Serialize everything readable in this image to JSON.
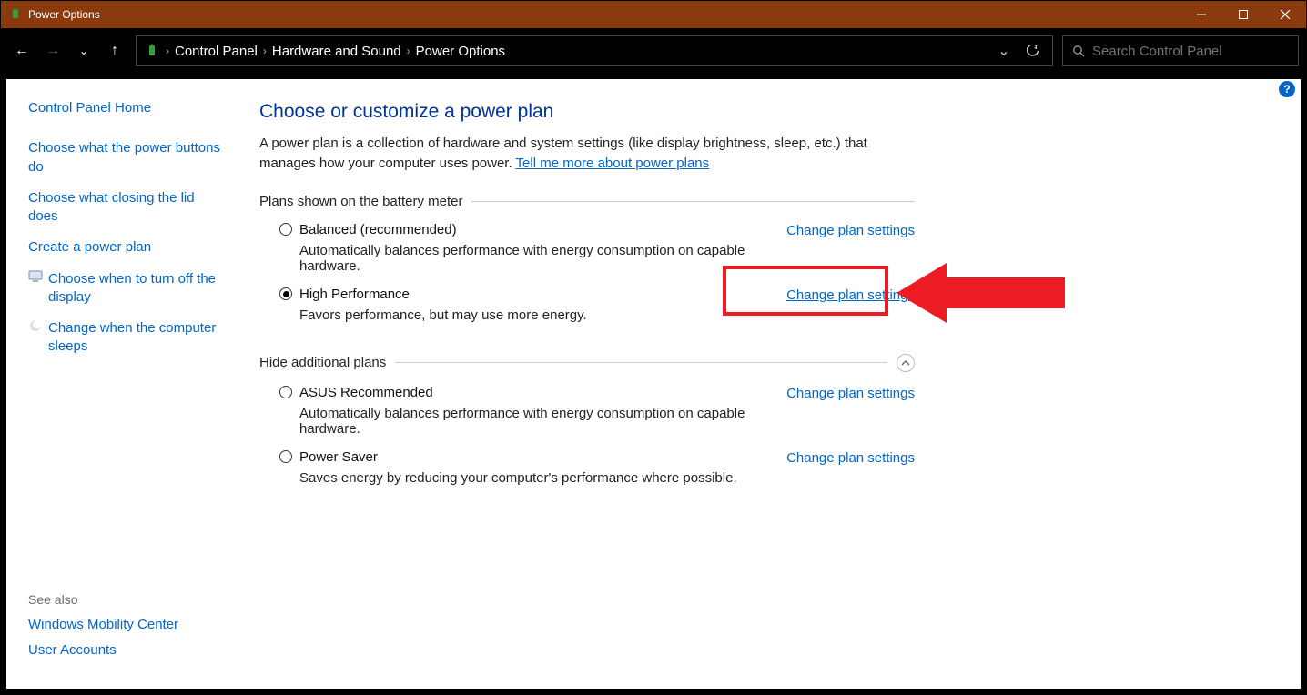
{
  "window": {
    "title": "Power Options"
  },
  "breadcrumbs": {
    "a": "Control Panel",
    "b": "Hardware and Sound",
    "c": "Power Options"
  },
  "search": {
    "placeholder": "Search Control Panel"
  },
  "sidebar": {
    "home": "Control Panel Home",
    "links": {
      "l0": "Choose what the power buttons do",
      "l1": "Choose what closing the lid does",
      "l2": "Create a power plan",
      "l3": "Choose when to turn off the display",
      "l4": "Change when the computer sleeps"
    },
    "see_also_label": "See also",
    "see_also": {
      "s0": "Windows Mobility Center",
      "s1": "User Accounts"
    }
  },
  "main": {
    "heading": "Choose or customize a power plan",
    "intro_a": "A power plan is a collection of hardware and system settings (like display brightness, sleep, etc.) that manages how your computer uses power. ",
    "intro_link": "Tell me more about power plans",
    "section1": "Plans shown on the battery meter",
    "section2": "Hide additional plans",
    "change_link": "Change plan settings",
    "plans": {
      "p0": {
        "name": "Balanced (recommended)",
        "desc": "Automatically balances performance with energy consumption on capable hardware."
      },
      "p1": {
        "name": "High Performance",
        "desc": "Favors performance, but may use more energy."
      },
      "p2": {
        "name": "ASUS Recommended",
        "desc": "Automatically balances performance with energy consumption on capable hardware."
      },
      "p3": {
        "name": "Power Saver",
        "desc": "Saves energy by reducing your computer's performance where possible."
      }
    }
  }
}
